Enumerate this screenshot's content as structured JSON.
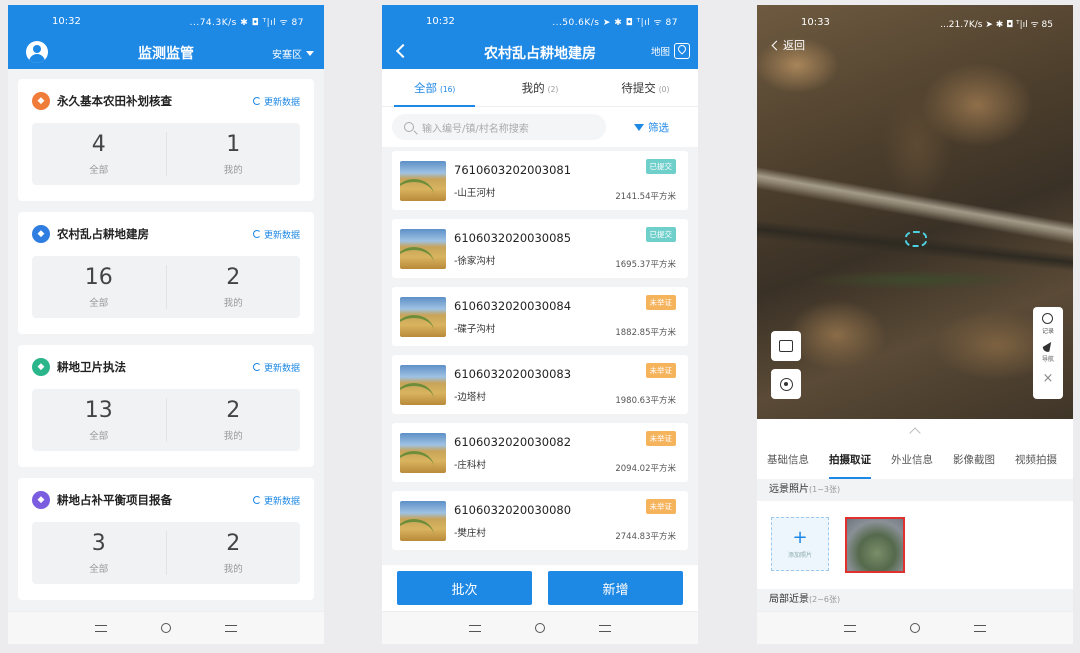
{
  "p1": {
    "status": {
      "time": "10:32",
      "right": "...74.3K/s ✱ ◘ ᵀ|ıl ᯤ 87"
    },
    "title": "监测监管",
    "region": "安塞区",
    "refresh_label": "更新数据",
    "cards": [
      {
        "title": "永久基本农田补划核查",
        "icon_color": "#f07c3a",
        "all": "4",
        "mine": "1",
        "all_label": "全部",
        "mine_label": "我的"
      },
      {
        "title": "农村乱占耕地建房",
        "icon_color": "#2f7de0",
        "all": "16",
        "mine": "2",
        "all_label": "全部",
        "mine_label": "我的"
      },
      {
        "title": "耕地卫片执法",
        "icon_color": "#2ab58a",
        "all": "13",
        "mine": "2",
        "all_label": "全部",
        "mine_label": "我的"
      },
      {
        "title": "耕地占补平衡项目报备",
        "icon_color": "#7b5de0",
        "all": "3",
        "mine": "2",
        "all_label": "全部",
        "mine_label": "我的"
      }
    ]
  },
  "p2": {
    "status": {
      "time": "10:32",
      "right": "...50.6K/s ➤ ✱ ◘ ᵀ|ıl ᯤ 87"
    },
    "title": "农村乱占耕地建房",
    "map_label": "地图",
    "tabs": [
      {
        "label": "全部",
        "count": "(16)"
      },
      {
        "label": "我的",
        "count": "(2)"
      },
      {
        "label": "待提交",
        "count": "(0)"
      }
    ],
    "search_placeholder": "输入编号/镇/村名称搜索",
    "filter_label": "筛选",
    "items": [
      {
        "code": "7610603202003081",
        "village": "-山王河村",
        "area": "2141.54平方米",
        "badge": "已提交",
        "badge_color": "#6fcfcb"
      },
      {
        "code": "6106032020030085",
        "village": "-徐家沟村",
        "area": "1695.37平方米",
        "badge": "已提交",
        "badge_color": "#6fcfcb"
      },
      {
        "code": "6106032020030084",
        "village": "-碟子沟村",
        "area": "1882.85平方米",
        "badge": "未举证",
        "badge_color": "#f5b35c"
      },
      {
        "code": "6106032020030083",
        "village": "-边塔村",
        "area": "1980.63平方米",
        "badge": "未举证",
        "badge_color": "#f5b35c"
      },
      {
        "code": "6106032020030082",
        "village": "-庄科村",
        "area": "2094.02平方米",
        "badge": "未举证",
        "badge_color": "#f5b35c"
      },
      {
        "code": "6106032020030080",
        "village": "-樊庄村",
        "area": "2744.83平方米",
        "badge": "未举证",
        "badge_color": "#f5b35c"
      }
    ],
    "btn_batch": "批次",
    "btn_add": "新增"
  },
  "p3": {
    "status": {
      "time": "10:33",
      "right": "...21.7K/s ➤ ✱ ◘ ᵀ|ıl ᯤ 85"
    },
    "back_label": "返回",
    "side_history": "记录",
    "side_nav": "导航",
    "side_close": "×",
    "tabs": [
      "基础信息",
      "拍摄取证",
      "外业信息",
      "影像截图",
      "视频拍摄"
    ],
    "active_tab": 1,
    "far_title": "远景照片",
    "far_range": "(1~3张)",
    "add_photo_label": "添加照片",
    "near_title": "局部近景",
    "near_range": "(2~6张)"
  }
}
